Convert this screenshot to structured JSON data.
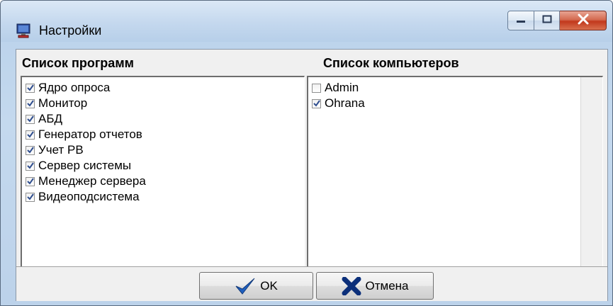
{
  "window": {
    "title": "Настройки",
    "icons": {
      "app": "computer-icon",
      "minimize": "minimize-icon",
      "maximize": "maximize-icon",
      "close": "close-icon"
    }
  },
  "programs": {
    "header": "Список программ",
    "items": [
      {
        "label": "Ядро опроса",
        "checked": true
      },
      {
        "label": "Монитор",
        "checked": true
      },
      {
        "label": "АБД",
        "checked": true
      },
      {
        "label": "Генератор отчетов",
        "checked": true
      },
      {
        "label": "Учет РВ",
        "checked": true
      },
      {
        "label": "Сервер системы",
        "checked": true
      },
      {
        "label": "Менеджер сервера",
        "checked": true
      },
      {
        "label": "Видеоподсистема",
        "checked": true
      }
    ]
  },
  "computers": {
    "header": "Список компьютеров",
    "items": [
      {
        "label": "Admin",
        "checked": false
      },
      {
        "label": "Ohrana",
        "checked": true
      }
    ]
  },
  "buttons": {
    "ok": {
      "label": "OK",
      "icon": "checkmark-icon",
      "color": "#1f5fbf"
    },
    "cancel": {
      "label": "Отмена",
      "icon": "x-icon",
      "color": "#0b2f7a"
    }
  }
}
